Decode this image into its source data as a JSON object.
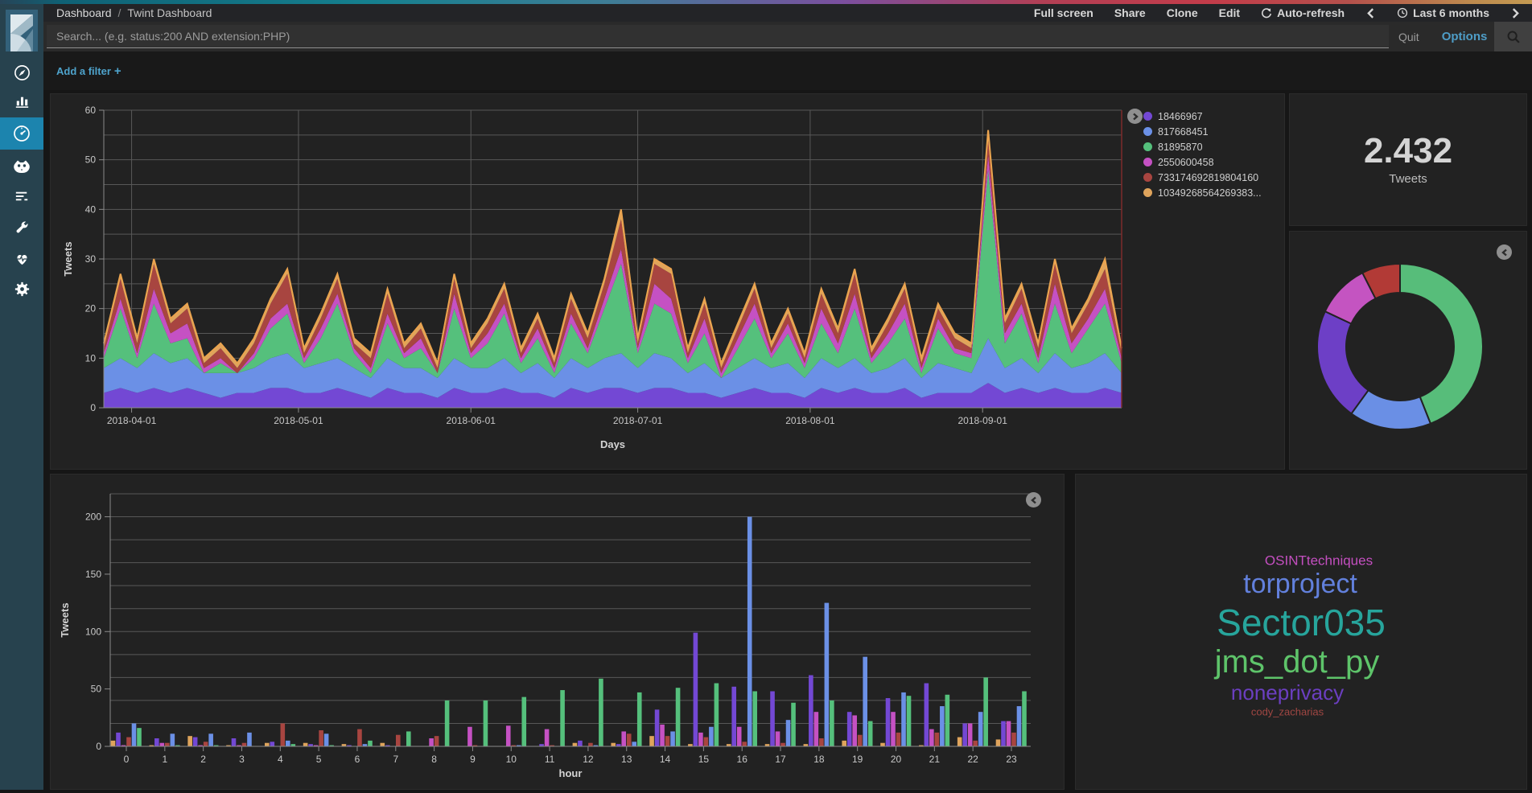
{
  "header": {
    "breadcrumb": {
      "root": "Dashboard",
      "separator": "/",
      "current": "Twint Dashboard"
    },
    "menu": [
      {
        "label": "Full screen"
      },
      {
        "label": "Share"
      },
      {
        "label": "Clone"
      },
      {
        "label": "Edit"
      },
      {
        "label": "Auto-refresh",
        "icon": "refresh-icon"
      }
    ],
    "time_picker": {
      "label": "Last 6 months",
      "icon": "clock-icon",
      "prev": "chevron-left-icon",
      "next": "chevron-right-icon"
    }
  },
  "search": {
    "placeholder": "Search... (e.g. status:200 AND extension:PHP)",
    "quit_label": "Quit",
    "options_label": "Options",
    "button_icon": "magnifier-icon"
  },
  "filter_bar": {
    "add_filter_label": "Add a filter",
    "plus": "+"
  },
  "sidebar": {
    "logo_icon": "kibana-logo",
    "items": [
      {
        "icon": "compass-icon",
        "active": false
      },
      {
        "icon": "bar-chart-icon",
        "active": false
      },
      {
        "icon": "gauge-dashboard-icon",
        "active": true
      },
      {
        "icon": "owl-face-icon",
        "active": false
      },
      {
        "icon": "log-lines-icon",
        "active": false
      },
      {
        "icon": "wrench-icon",
        "active": false
      },
      {
        "icon": "heartbeat-icon",
        "active": false
      },
      {
        "icon": "gear-icon",
        "active": false
      }
    ]
  },
  "colors": {
    "purple": "#7348d4",
    "blue": "#6b90e6",
    "green": "#55c07c",
    "magenta": "#c551c3",
    "red": "#a84540",
    "orange": "#dfa45c",
    "grid": "#585858",
    "axis": "#8b8b8b",
    "tick_text": "#c8c8c8",
    "end_marker": "#7d2a2a",
    "panel_bg": "#222222",
    "accent_blue": "#4ea3cc"
  },
  "chart_data": [
    {
      "panel": "timeseries",
      "type": "area",
      "stacked": true,
      "xlabel": "Days",
      "ylabel": "Tweets",
      "ylim": [
        0,
        60
      ],
      "y_major_ticks": [
        0,
        10,
        20,
        30,
        40,
        50,
        60
      ],
      "y_minor_step": 5,
      "x_start_day": 0,
      "x_end_day": 183,
      "x_step_days": 3,
      "x_ticks": [
        {
          "label": "2018-04-01",
          "day": 5
        },
        {
          "label": "2018-05-01",
          "day": 35
        },
        {
          "label": "2018-06-01",
          "day": 66
        },
        {
          "label": "2018-07-01",
          "day": 96
        },
        {
          "label": "2018-08-01",
          "day": 127
        },
        {
          "label": "2018-09-01",
          "day": 158
        }
      ],
      "legend_toggle_icon": "chevron-right-icon",
      "series": [
        {
          "name": "18466967",
          "color": "#7348d4",
          "values": [
            3,
            4,
            3,
            4,
            3,
            4,
            3,
            2,
            3,
            3,
            4,
            4,
            3,
            3,
            4,
            3,
            2,
            4,
            3,
            3,
            2,
            4,
            3,
            3,
            4,
            3,
            3,
            2,
            4,
            3,
            4,
            4,
            3,
            4,
            4,
            3,
            3,
            2,
            3,
            4,
            3,
            3,
            2,
            4,
            3,
            4,
            3,
            3,
            4,
            2,
            3,
            3,
            3,
            5,
            3,
            4,
            3,
            4,
            3,
            3,
            4,
            3
          ]
        },
        {
          "name": "817668451",
          "color": "#6b90e6",
          "values": [
            5,
            6,
            5,
            7,
            6,
            6,
            4,
            5,
            4,
            5,
            6,
            7,
            5,
            6,
            6,
            5,
            4,
            6,
            5,
            5,
            4,
            6,
            5,
            5,
            6,
            4,
            6,
            4,
            6,
            5,
            6,
            7,
            5,
            7,
            6,
            4,
            6,
            4,
            5,
            6,
            5,
            6,
            4,
            6,
            5,
            6,
            4,
            5,
            6,
            4,
            6,
            5,
            4,
            9,
            5,
            6,
            4,
            7,
            5,
            6,
            7,
            4
          ]
        },
        {
          "name": "81895870",
          "color": "#55c07c",
          "values": [
            2,
            10,
            2,
            10,
            4,
            4,
            0,
            2,
            0,
            2,
            6,
            8,
            1,
            5,
            11,
            3,
            1,
            7,
            2,
            4,
            1,
            10,
            2,
            5,
            9,
            2,
            5,
            1,
            7,
            3,
            10,
            18,
            3,
            10,
            9,
            2,
            6,
            0,
            4,
            8,
            2,
            6,
            2,
            7,
            3,
            10,
            2,
            5,
            8,
            1,
            7,
            3,
            3,
            34,
            5,
            9,
            2,
            10,
            3,
            7,
            10,
            2
          ]
        },
        {
          "name": "2550600458",
          "color": "#c551c3",
          "values": [
            1,
            2,
            1,
            3,
            2,
            3,
            1,
            1,
            0,
            1,
            2,
            2,
            1,
            2,
            2,
            1,
            1,
            2,
            1,
            2,
            0,
            3,
            1,
            2,
            2,
            1,
            2,
            1,
            2,
            1,
            2,
            3,
            1,
            4,
            3,
            1,
            3,
            1,
            2,
            3,
            1,
            2,
            1,
            3,
            2,
            3,
            1,
            2,
            3,
            1,
            2,
            1,
            1,
            3,
            2,
            2,
            1,
            4,
            2,
            2,
            3,
            1
          ]
        },
        {
          "name": "733174692819804160",
          "color": "#a84540",
          "values": [
            1,
            4,
            2,
            5,
            2,
            3,
            1,
            2,
            1,
            2,
            3,
            6,
            1,
            2,
            3,
            1,
            2,
            4,
            1,
            2,
            1,
            3,
            1,
            2,
            3,
            1,
            2,
            1,
            3,
            2,
            3,
            6,
            1,
            4,
            5,
            1,
            3,
            1,
            2,
            3,
            1,
            2,
            1,
            3,
            2,
            4,
            1,
            2,
            3,
            1,
            2,
            2,
            1,
            3,
            2,
            3,
            2,
            4,
            2,
            3,
            4,
            1
          ]
        },
        {
          "name": "10349268564269383...",
          "color": "#dfa45c",
          "values": [
            1,
            1,
            1,
            1,
            1,
            1,
            1,
            1,
            1,
            1,
            1,
            1,
            1,
            1,
            1,
            1,
            1,
            1,
            1,
            1,
            1,
            1,
            1,
            1,
            1,
            1,
            1,
            1,
            1,
            1,
            1,
            2,
            1,
            1,
            1,
            1,
            1,
            1,
            1,
            1,
            1,
            1,
            1,
            1,
            1,
            1,
            1,
            1,
            1,
            1,
            1,
            1,
            1,
            2,
            1,
            1,
            1,
            1,
            1,
            1,
            2,
            1
          ]
        }
      ]
    },
    {
      "panel": "metric",
      "type": "metric",
      "value": "2.432",
      "label": "Tweets"
    },
    {
      "panel": "donut",
      "type": "pie",
      "donut": true,
      "legend_toggle_icon": "chevron-left-icon",
      "slices": [
        {
          "label": "81895870",
          "pct": 44,
          "color": "#57bd7a"
        },
        {
          "label": "817668451",
          "pct": 16,
          "color": "#6a8fe5"
        },
        {
          "label": "18466967",
          "pct": 22,
          "color": "#6d3fc6"
        },
        {
          "label": "2550600458",
          "pct": 10.5,
          "color": "#c454c1"
        },
        {
          "label": "733174692819804160",
          "pct": 7.5,
          "color": "#b23a36"
        }
      ]
    },
    {
      "panel": "hourly",
      "type": "bar",
      "grouped": true,
      "legend_toggle_icon": "chevron-left-icon",
      "xlabel": "hour",
      "ylabel": "Tweets",
      "ylim": [
        0,
        220
      ],
      "y_major_ticks": [
        0,
        50,
        100,
        150,
        200
      ],
      "y_minor_step": 20,
      "categories": [
        0,
        1,
        2,
        3,
        4,
        5,
        6,
        7,
        8,
        9,
        10,
        11,
        12,
        13,
        14,
        15,
        16,
        17,
        18,
        19,
        20,
        21,
        22,
        23
      ],
      "series": [
        {
          "name": "10349268564269383...",
          "color": "#dfa45c",
          "values": [
            5,
            1,
            9,
            1,
            3,
            3,
            2,
            3,
            0,
            0,
            0,
            0,
            3,
            3,
            9,
            2,
            2,
            2,
            2,
            5,
            3,
            1,
            8,
            6
          ]
        },
        {
          "name": "18466967",
          "color": "#7348d4",
          "values": [
            12,
            7,
            8,
            7,
            4,
            2,
            1,
            1,
            0,
            0,
            0,
            2,
            5,
            2,
            32,
            99,
            52,
            48,
            62,
            30,
            42,
            55,
            20,
            22
          ]
        },
        {
          "name": "2550600458",
          "color": "#c551c3",
          "values": [
            1,
            3,
            1,
            1,
            0,
            1,
            0,
            0,
            7,
            17,
            18,
            15,
            0,
            13,
            19,
            12,
            17,
            13,
            30,
            27,
            30,
            15,
            20,
            22
          ]
        },
        {
          "name": "733174692819804160",
          "color": "#a84540",
          "values": [
            8,
            3,
            4,
            3,
            20,
            14,
            15,
            10,
            9,
            1,
            1,
            1,
            3,
            11,
            9,
            8,
            4,
            3,
            7,
            10,
            12,
            12,
            5,
            12
          ]
        },
        {
          "name": "817668451",
          "color": "#6b90e6",
          "values": [
            20,
            11,
            11,
            12,
            5,
            11,
            2,
            0,
            0,
            0,
            1,
            0,
            1,
            4,
            13,
            17,
            200,
            23,
            125,
            78,
            47,
            35,
            30,
            35
          ]
        },
        {
          "name": "81895870",
          "color": "#55c07c",
          "values": [
            16,
            1,
            1,
            0,
            2,
            1,
            5,
            13,
            40,
            40,
            43,
            49,
            59,
            47,
            51,
            55,
            48,
            38,
            40,
            22,
            44,
            45,
            60,
            48
          ]
        }
      ]
    },
    {
      "panel": "tagcloud",
      "type": "tagcloud",
      "words": [
        {
          "text": "OSINTtechniques",
          "color": "#c44fc0",
          "size": 17
        },
        {
          "text": "torproject",
          "color": "#6280dc",
          "size": 34
        },
        {
          "text": "Sector035",
          "color": "#27a59c",
          "size": 46
        },
        {
          "text": "jms_dot_py",
          "color": "#5ec46a",
          "size": 40
        },
        {
          "text": "noneprivacy",
          "color": "#6b3fc0",
          "size": 26
        },
        {
          "text": "cody_zacharias",
          "color": "#a04743",
          "size": 13
        }
      ]
    }
  ]
}
